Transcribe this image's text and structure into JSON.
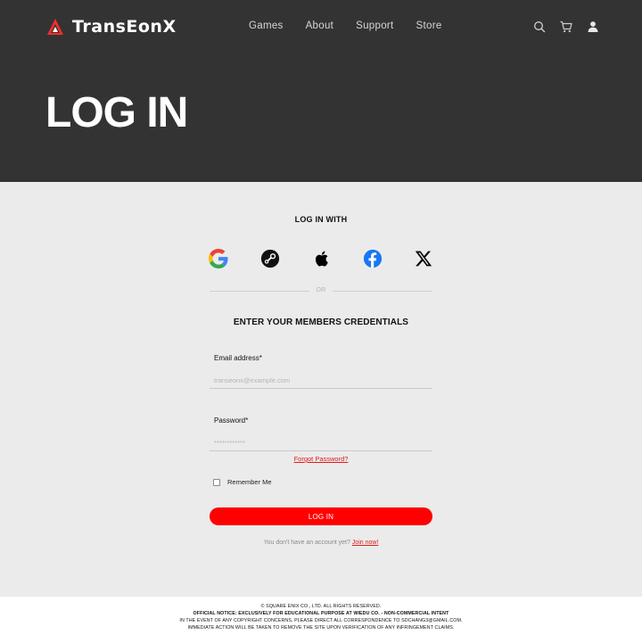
{
  "header": {
    "brand": "TransEonX",
    "nav": [
      "Games",
      "About",
      "Support",
      "Store"
    ],
    "icons": [
      "search-icon",
      "cart-icon",
      "user-icon"
    ]
  },
  "page": {
    "title": "LOG IN"
  },
  "social_login": {
    "heading": "LOG IN WITH",
    "providers": [
      "google-icon",
      "steam-icon",
      "apple-icon",
      "facebook-icon",
      "x-icon"
    ],
    "divider": "OR"
  },
  "form": {
    "heading": "ENTER YOUR MEMBERS CREDENTIALS",
    "email": {
      "label": "Email address*",
      "placeholder": "transeonx@example.com"
    },
    "password": {
      "label": "Password*",
      "placeholder": "************"
    },
    "forgot": "Forgot Password?",
    "remember": "Remember Me",
    "submit": "LOG IN",
    "signup_prompt": "You don't have an account yet?",
    "signup_link": "Join now!"
  },
  "footer": {
    "lines": [
      "© SQUARE ENIX CO., LTD. ALL RIGHTS RESERVED.",
      "OFFICIAL NOTICE: EXCLUSIVELY FOR EDUCATIONAL PURPOSE AT WIEDU CO. - NON-COMMERCIAL INTENT",
      "IN THE EVENT OF ANY COPYRIGHT CONCERNS, PLEASE DIRECT ALL CORRESPONDENCE TO SDCHANG3@GMAIL.COM.",
      "IMMEDIATE ACTION WILL BE TAKEN TO REMOVE THE SITE UPON VERIFICATION OF ANY INFRINGEMENT CLAIMS."
    ]
  },
  "colors": {
    "header_bg": "#333333",
    "page_bg": "#ebebeb",
    "accent": "#ff0000",
    "link": "#e11a1a",
    "footer_bg": "#ffffff"
  }
}
